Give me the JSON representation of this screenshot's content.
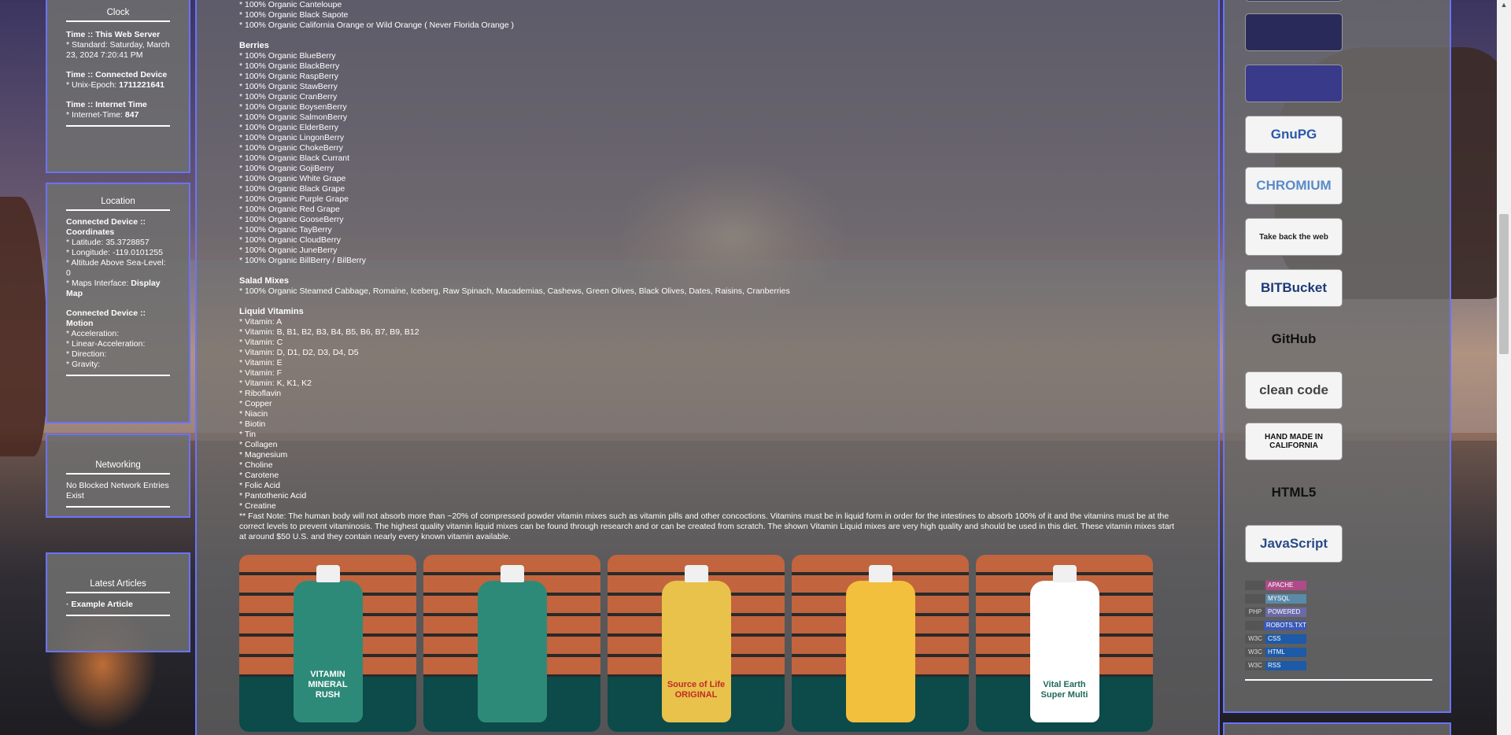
{
  "clock": {
    "title": "Clock",
    "server_head": "Time :: This Web Server",
    "server_val": "* Standard: Saturday, March 23, 2024 7:20:41 PM",
    "device_head": "Time :: Connected Device",
    "epoch_label": "* Unix-Epoch: ",
    "epoch_val": "1711221641",
    "internet_head": "Time :: Internet Time",
    "internet_label": "* Internet-Time: ",
    "internet_val": "847"
  },
  "location": {
    "title": "Location",
    "coords_head": "Connected Device :: Coordinates",
    "latitude": "* Latitude: 35.3728857",
    "longitude": "* Longitude: -119.0101255",
    "altitude": "* Altitude Above Sea-Level: 0",
    "maps_label": "* Maps Interface: ",
    "maps_link": "Display Map",
    "motion_head": "Connected Device :: Motion",
    "acceleration": "* Acceleration:",
    "linear": "* Linear-Acceleration:",
    "direction": "* Direction:",
    "gravity": "* Gravity:"
  },
  "networking": {
    "title": "Networking",
    "text": "No Blocked Network Entries Exist"
  },
  "articles": {
    "title": "Latest Articles",
    "item": "· Example Article"
  },
  "content": {
    "top_lines": [
      "* 100% Organic Canteloupe",
      "* 100% Organic Black Sapote",
      "* 100% Organic California Orange or Wild Orange ( Never Florida Orange )"
    ],
    "berries_title": "Berries",
    "berries": [
      "* 100% Organic BlueBerry",
      "* 100% Organic BlackBerry",
      "* 100% Organic RaspBerry",
      "* 100% Organic StawBerry",
      "* 100% Organic CranBerry",
      "* 100% Organic BoysenBerry",
      "* 100% Organic SalmonBerry",
      "* 100% Organic ElderBerry",
      "* 100% Organic LingonBerry",
      "* 100% Organic ChokeBerry",
      "* 100% Organic Black Currant",
      "* 100% Organic GojiBerry",
      "* 100% Organic White Grape",
      "* 100% Organic Black Grape",
      "* 100% Organic Purple Grape",
      "* 100% Organic Red Grape",
      "* 100% Organic GooseBerry",
      "* 100% Organic TayBerry",
      "* 100% Organic CloudBerry",
      "* 100% Organic JuneBerry",
      "* 100% Organic BillBerry / BilBerry"
    ],
    "salad_title": "Salad Mixes",
    "salad": "* 100% Organic Steamed Cabbage, Romaine, Iceberg, Raw Spinach, Macademias, Cashews, Green Olives, Black Olives, Dates, Raisins, Cranberries",
    "vitamins_title": "Liquid Vitamins",
    "vitamins": [
      "* Vitamin: A",
      "* Vitamin: B, B1, B2, B3, B4, B5, B6, B7, B9, B12",
      "* Vitamin: C",
      "* Vitamin: D, D1, D2, D3, D4, D5",
      "* Vitamin: E",
      "* Vitamin: F",
      "* Vitamin: K, K1, K2",
      "* Riboflavin",
      "* Copper",
      "* Niacin",
      "* Biotin",
      "* Tin",
      "* Collagen",
      "* Magnesium",
      "* Choline",
      "* Carotene",
      "* Folic Acid",
      "* Pantothenic Acid",
      "* Creatine"
    ],
    "note": "** Fast Note: The human body will not absorb more than ~20% of compressed powder vitamin mixes such as vitamin pills and other concoctions. Vitamins must be in liquid form in order for the intestines to absorb 100% of it and the vitamins must be at the correct levels to prevent vitaminosis. The highest quality vitamin liquid mixes can be found through research and or can be created from scratch. The shown Vitamin Liquid mixes are very high quality and should be used in this diet. These vitamin mixes start at around $50 U.S. and they contain nearly every known vitamin available."
  },
  "photos": [
    {
      "label": "VITAMIN MINERAL RUSH",
      "bottle_color": "#2e8a78",
      "label_color": "#ffffff"
    },
    {
      "label": "",
      "bottle_color": "#2e8a78",
      "label_color": "#ffffff"
    },
    {
      "label": "Source of Life ORIGINAL",
      "bottle_color": "#e8c24a",
      "label_color": "#c22a2a"
    },
    {
      "label": "",
      "bottle_color": "#f2c03c",
      "label_color": "#ffffff"
    },
    {
      "label": "Vital Earth Super Multi",
      "bottle_color": "#ffffff",
      "label_color": "#1d6a5a"
    }
  ],
  "badges": [
    {
      "name": "security-badge",
      "text": "",
      "bg": "#2a2a5a",
      "fg": "#ffffff"
    },
    {
      "name": "encryption-badge",
      "text": "",
      "bg": "#3a3a8a",
      "fg": "#ffffff"
    },
    {
      "name": "gnupg-badge",
      "text": "GnuPG",
      "bg": "#f4f4f4",
      "fg": "#2a5aa8"
    },
    {
      "name": "chromium-badge",
      "text": "CHROMIUM",
      "bg": "#f4f4f4",
      "fg": "#5a8ac8"
    },
    {
      "name": "firefox-badge",
      "text": "Take back the web",
      "bg": "#f4f4f4",
      "fg": "#222222"
    },
    {
      "name": "bitbucket-badge",
      "text": "BITBucket",
      "bg": "#f4f4f4",
      "fg": "#1d3a7a"
    },
    {
      "name": "github-badge",
      "text": "GitHub",
      "bg": "transparent",
      "fg": "#111111"
    },
    {
      "name": "clean-code-badge",
      "text": "clean code",
      "bg": "#f4f4f4",
      "fg": "#444444"
    },
    {
      "name": "handmade-badge",
      "text": "HAND MADE IN CALIFORNIA",
      "bg": "#f4f4f4",
      "fg": "#111111"
    },
    {
      "name": "html5-badge",
      "text": "HTML5",
      "bg": "transparent",
      "fg": "#111111"
    },
    {
      "name": "javascript-badge",
      "text": "JavaScript",
      "bg": "#f4f4f4",
      "fg": "#2a4a8a"
    }
  ],
  "mini_badges": [
    {
      "left": "",
      "right": "APACHE",
      "color": "#b04a8a"
    },
    {
      "left": "",
      "right": "MYSQL",
      "color": "#5a8aa8"
    },
    {
      "left": "PHP",
      "right": "POWERED",
      "color": "#6a6aa8"
    },
    {
      "left": "",
      "right": "ROBOTS.TXT",
      "color": "#3a5ab8"
    },
    {
      "left": "W3C",
      "right": "CSS",
      "color": "#1d5aa8"
    },
    {
      "left": "W3C",
      "right": "HTML",
      "color": "#1d5aa8"
    },
    {
      "left": "W3C",
      "right": "RSS",
      "color": "#1d5aa8"
    }
  ]
}
